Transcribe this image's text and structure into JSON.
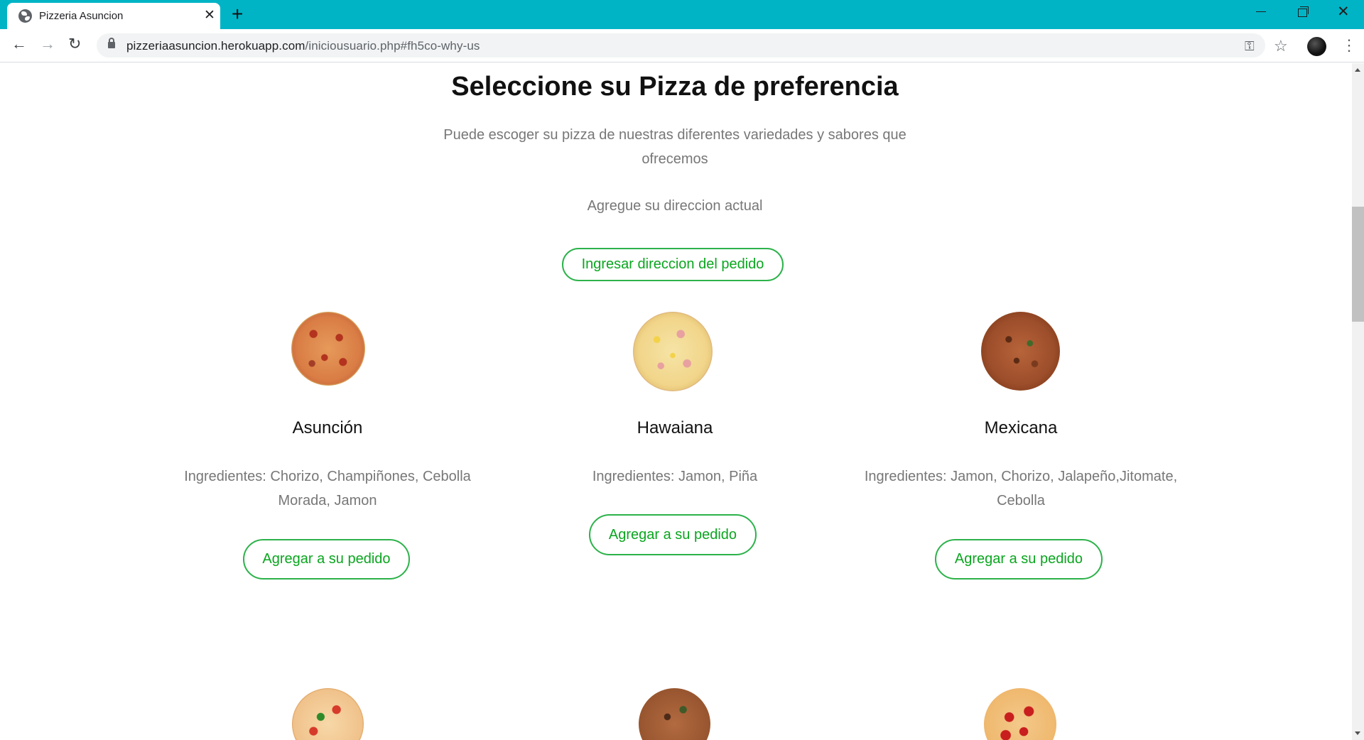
{
  "browser": {
    "tab_title": "Pizzeria Asuncion",
    "url_host": "pizzeriaasuncion.herokuapp.com",
    "url_path": "/iniciousuario.php#fh5co-why-us"
  },
  "page": {
    "title": "Seleccione su Pizza de preferencia",
    "subtitle": "Puede escoger su pizza de nuestras diferentes variedades y sabores que ofrecemos",
    "address_prompt": "Agregue su direccion actual",
    "address_button": "Ingresar direccion del pedido"
  },
  "pizzas": [
    {
      "name": "Asunción",
      "ingredients": "Ingredientes: Chorizo, Champiñones, Cebolla Morada, Jamon",
      "button": "Agregar a su pedido"
    },
    {
      "name": "Hawaiana",
      "ingredients": "Ingredientes: Jamon, Piña",
      "button": "Agregar a su pedido"
    },
    {
      "name": "Mexicana",
      "ingredients": "Ingredientes: Jamon, Chorizo, Jalapeño,Jitomate, Cebolla",
      "button": "Agregar a su pedido"
    }
  ],
  "icons": {
    "favicon": "globe-icon",
    "tab_close": "close-icon",
    "new_tab": "plus-icon",
    "back": "arrow-left-icon",
    "forward": "arrow-right-icon",
    "reload": "reload-icon",
    "lock": "lock-icon",
    "key": "key-icon",
    "bookmark": "star-icon",
    "menu": "kebab-menu-icon"
  },
  "colors": {
    "tab_strip": "#00b4c6",
    "accent_green": "#0aa61f",
    "muted_text": "#777777"
  }
}
